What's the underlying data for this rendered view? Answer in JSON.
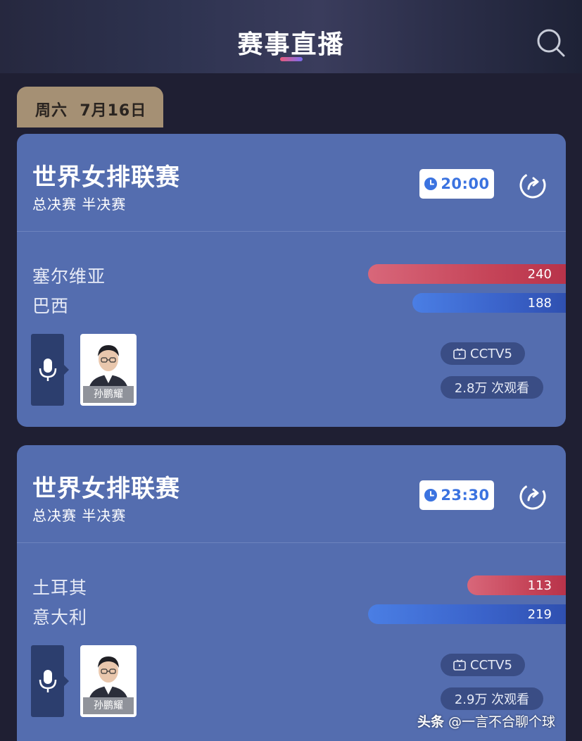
{
  "header": {
    "title": "赛事直播"
  },
  "date_tab": "周六  7月16日",
  "matches": [
    {
      "title": "世界女排联赛",
      "subtitle": "总决赛 半决赛",
      "time": "20:00",
      "team1": {
        "name": "塞尔维亚",
        "votes": "240",
        "bar_fraction": 0.36
      },
      "team2": {
        "name": "巴西",
        "votes": "188",
        "bar_fraction": 0.28
      },
      "commentator": "孙鹏耀",
      "channel": "CCTV5",
      "views": "2.8万 次观看"
    },
    {
      "title": "世界女排联赛",
      "subtitle": "总决赛 半决赛",
      "time": "23:30",
      "team1": {
        "name": "土耳其",
        "votes": "113",
        "bar_fraction": 0.18
      },
      "team2": {
        "name": "意大利",
        "votes": "219",
        "bar_fraction": 0.36
      },
      "commentator": "孙鹏耀",
      "channel": "CCTV5",
      "views": "2.9万 次观看"
    }
  ],
  "watermark": {
    "brand": "头条",
    "account": " @一言不合聊个球"
  },
  "icons": {
    "search": "search-icon",
    "clock": "clock-icon",
    "share": "share-icon",
    "mic": "microphone-icon",
    "tv": "tv-icon"
  },
  "colors": {
    "card_bg": "#546daf",
    "date_tab_bg": "#a59074",
    "team1_bar": "#c64559",
    "team2_bar": "#3a62c9",
    "time_text": "#3b73e0"
  }
}
